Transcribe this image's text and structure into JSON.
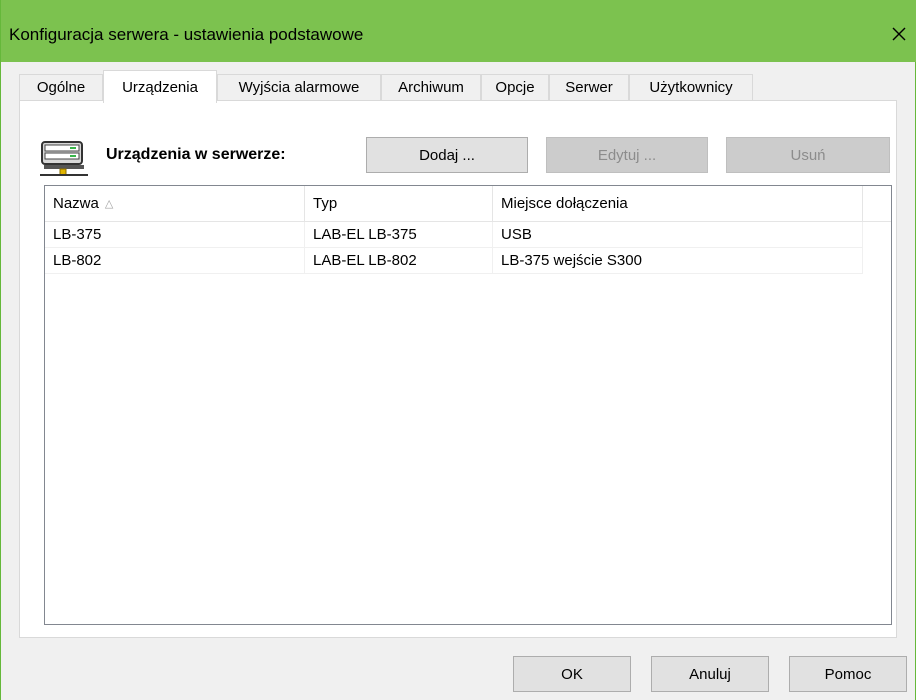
{
  "window": {
    "title": "Konfiguracja serwera - ustawienia podstawowe",
    "accent_color": "#7cc24f"
  },
  "tabs": [
    {
      "label": "Ogólne"
    },
    {
      "label": "Urządzenia",
      "active": true
    },
    {
      "label": "Wyjścia alarmowe"
    },
    {
      "label": "Archiwum"
    },
    {
      "label": "Opcje"
    },
    {
      "label": "Serwer"
    },
    {
      "label": "Użytkownicy"
    }
  ],
  "devices_section": {
    "label": "Urządzenia w serwerze:",
    "icon": "server-icon",
    "add_label": "Dodaj ...",
    "edit_label": "Edytuj ...",
    "delete_label": "Usuń"
  },
  "device_table": {
    "columns": [
      "Nazwa",
      "Typ",
      "Miejsce dołączenia"
    ],
    "sort_indicator": "△",
    "rows": [
      [
        "LB-375",
        "LAB-EL LB-375",
        "USB"
      ],
      [
        "LB-802",
        "LAB-EL LB-802",
        "LB-375 wejście S300"
      ]
    ]
  },
  "footer": {
    "ok_label": "OK",
    "cancel_label": "Anuluj",
    "help_label": "Pomoc"
  }
}
